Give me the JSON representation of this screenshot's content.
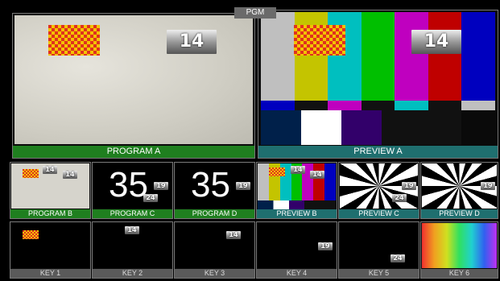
{
  "header": {
    "pgm_label": "PGM"
  },
  "main": {
    "program": {
      "label": "PROGRAM A",
      "badge": "14"
    },
    "preview": {
      "label": "PREVIEW A",
      "badge": "14"
    }
  },
  "thumbnails": {
    "program_b": {
      "label": "PROGRAM B",
      "badge_a": "14",
      "badge_b": "14"
    },
    "program_c": {
      "label": "PROGRAM C",
      "number": "35",
      "badge_a": "19",
      "badge_b": "24"
    },
    "program_d": {
      "label": "PROGRAM D",
      "number": "35",
      "badge_a": "19"
    },
    "preview_b": {
      "label": "PREVIEW B",
      "badge_a": "14",
      "badge_b": "14"
    },
    "preview_c": {
      "label": "PREVIEW C",
      "badge_a": "19",
      "badge_b": "24"
    },
    "preview_d": {
      "label": "PREVIEW D",
      "badge_a": "19"
    }
  },
  "keys": {
    "key1": {
      "label": "KEY 1"
    },
    "key2": {
      "label": "KEY 2",
      "badge": "14"
    },
    "key3": {
      "label": "KEY 3",
      "badge": "14"
    },
    "key4": {
      "label": "KEY 4",
      "badge": "19"
    },
    "key5": {
      "label": "KEY 5",
      "badge": "24"
    },
    "key6": {
      "label": "KEY 6"
    }
  },
  "colors": {
    "program_green": "#1f7f1f",
    "preview_teal": "#1f6f6f",
    "key_gray": "#5a5a5a"
  }
}
